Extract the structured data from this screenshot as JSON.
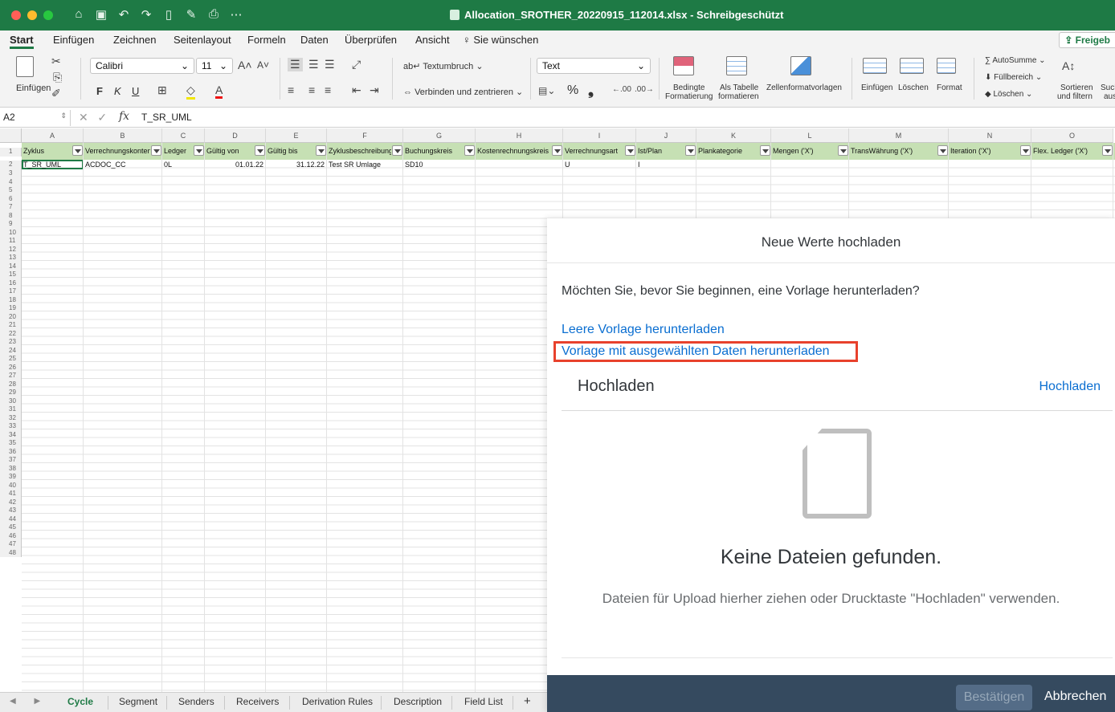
{
  "window": {
    "title": "Allocation_SROTHER_20220915_112014.xlsx - Schreibgeschützt"
  },
  "menu": {
    "tabs": [
      "Start",
      "Einfügen",
      "Zeichnen",
      "Seitenlayout",
      "Formeln",
      "Daten",
      "Überprüfen",
      "Ansicht"
    ],
    "tell_me": "Sie wünschen",
    "share": "Freigeb"
  },
  "ribbon": {
    "paste": "Einfügen",
    "font": "Calibri",
    "font_size": "11",
    "bold": "F",
    "italic": "K",
    "underline": "U",
    "wrap_text": "Textumbruch",
    "merge_center": "Verbinden und zentrieren",
    "number_format": "Text",
    "percent": "%",
    "thousands": "❟",
    "cond_format_1": "Bedingte",
    "cond_format_2": "Formatierung",
    "as_table_1": "Als Tabelle",
    "as_table_2": "formatieren",
    "cell_styles": "Zellenformatvorlagen",
    "insert": "Einfügen",
    "delete": "Löschen",
    "format": "Format",
    "autosum": "AutoSumme",
    "fill": "Füllbereich",
    "clear": "Löschen",
    "sort_1": "Sortieren",
    "sort_2": "und filtern",
    "find_1": "Such",
    "find_2": "aus"
  },
  "formula_bar": {
    "cell_ref": "A2",
    "fx": "fx",
    "value": "T_SR_UML"
  },
  "sheet": {
    "columns": [
      "A",
      "B",
      "C",
      "D",
      "E",
      "F",
      "G",
      "H",
      "I",
      "J",
      "K",
      "L",
      "M",
      "N",
      "O"
    ],
    "headers": [
      "Zyklus",
      "Verrechnungskonten",
      "Ledger",
      "Gültig von",
      "Gültig bis",
      "Zyklusbeschreibung",
      "Buchungskreis",
      "Kostenrechnungskreis",
      "Verrechnungsart",
      "Ist/Plan",
      "Plankategorie",
      "Mengen ('X')",
      "TransWährung ('X')",
      "Iteration ('X')",
      "Flex. Ledger ('X')"
    ],
    "row2": [
      "T_SR_UML",
      "ACDOC_CC",
      "0L",
      "01.01.22",
      "31.12.22",
      "Test SR Umlage",
      "SD10",
      "",
      "U",
      "I",
      "",
      "",
      "",
      "",
      ""
    ],
    "row_count": 48
  },
  "sheet_tabs": [
    "Cycle",
    "Segment",
    "Senders",
    "Receivers",
    "Derivation Rules",
    "Description",
    "Field List",
    "+"
  ],
  "dialog": {
    "title": "Neue Werte hochladen",
    "question": "Möchten Sie, bevor Sie beginnen, eine Vorlage herunterladen?",
    "link_empty": "Leere Vorlage herunterladen",
    "link_selected": "Vorlage mit ausgewählten Daten herunterladen",
    "upload_heading": "Hochladen",
    "upload_link": "Hochladen",
    "empty_title": "Keine Dateien gefunden.",
    "empty_desc": "Dateien für Upload hierher ziehen oder Drucktaste \"Hochladen\" verwenden.",
    "confirm": "Bestätigen",
    "cancel": "Abbrechen"
  },
  "colors": {
    "excel_green": "#1e7a45",
    "header_fill": "#c6e0b4",
    "link_blue": "#0a6ed1",
    "highlight_red": "#e8412c",
    "sap_footer": "#354a5f"
  }
}
